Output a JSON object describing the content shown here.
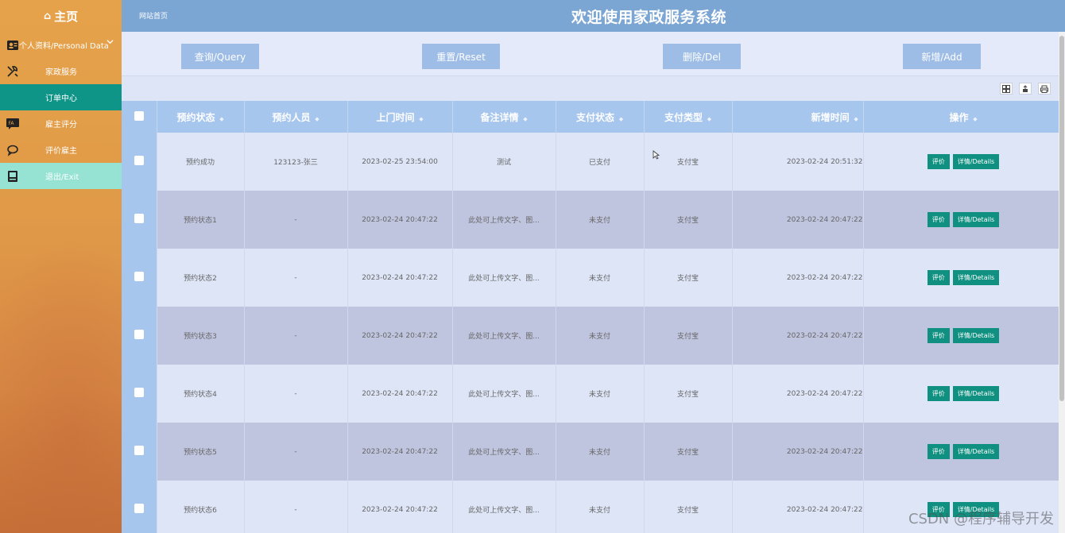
{
  "sidebar": {
    "home_label": "主页",
    "personal_label": "个人资料/Personal Data",
    "items": [
      {
        "label": "家政服务"
      },
      {
        "label": "订单中心"
      },
      {
        "label": "雇主评分"
      },
      {
        "label": "评价雇主"
      },
      {
        "label": "退出/Exit"
      }
    ]
  },
  "header": {
    "breadcrumb": "网站首页",
    "title": "欢迎使用家政服务系统"
  },
  "actions": {
    "query": "查询/Query",
    "reset": "重置/Reset",
    "delete": "删除/Del",
    "add": "新增/Add"
  },
  "table": {
    "headers": [
      "预约状态",
      "预约人员",
      "上门时间",
      "备注详情",
      "支付状态",
      "支付类型",
      "新增时间",
      "操作"
    ],
    "sort_glyph": "⬥",
    "rows": [
      {
        "status": "预约成功",
        "person": "123123-张三",
        "visit": "2023-02-25 23:54:00",
        "note": "测试",
        "pay_status": "已支付",
        "pay_type": "支付宝",
        "created": "2023-02-24 20:51:32"
      },
      {
        "status": "预约状态1",
        "person": "-",
        "visit": "2023-02-24 20:47:22",
        "note": "此处可上传文字、图...",
        "pay_status": "未支付",
        "pay_type": "支付宝",
        "created": "2023-02-24 20:47:22"
      },
      {
        "status": "预约状态2",
        "person": "-",
        "visit": "2023-02-24 20:47:22",
        "note": "此处可上传文字、图...",
        "pay_status": "未支付",
        "pay_type": "支付宝",
        "created": "2023-02-24 20:47:22"
      },
      {
        "status": "预约状态3",
        "person": "-",
        "visit": "2023-02-24 20:47:22",
        "note": "此处可上传文字、图...",
        "pay_status": "未支付",
        "pay_type": "支付宝",
        "created": "2023-02-24 20:47:22"
      },
      {
        "status": "预约状态4",
        "person": "-",
        "visit": "2023-02-24 20:47:22",
        "note": "此处可上传文字、图...",
        "pay_status": "未支付",
        "pay_type": "支付宝",
        "created": "2023-02-24 20:47:22"
      },
      {
        "status": "预约状态5",
        "person": "-",
        "visit": "2023-02-24 20:47:22",
        "note": "此处可上传文字、图...",
        "pay_status": "未支付",
        "pay_type": "支付宝",
        "created": "2023-02-24 20:47:22"
      },
      {
        "status": "预约状态6",
        "person": "-",
        "visit": "2023-02-24 20:47:22",
        "note": "此处可上传文字、图...",
        "pay_status": "未支付",
        "pay_type": "支付宝",
        "created": "2023-02-24 20:47:22"
      }
    ],
    "op_rate": "评价",
    "op_details": "详情/Details"
  },
  "watermark": "CSDN @程序辅导开发",
  "colors": {
    "accent": "#109080",
    "header_bar": "#7ba6d4",
    "table_header": "#a7c6ee",
    "button": "#9ebde6"
  },
  "icons": [
    "home-icon",
    "user-card-icon",
    "chevron-down-icon",
    "tools-icon",
    "rating-icon",
    "chat-icon",
    "exit-icon",
    "grid-icon",
    "export-icon",
    "print-icon"
  ]
}
